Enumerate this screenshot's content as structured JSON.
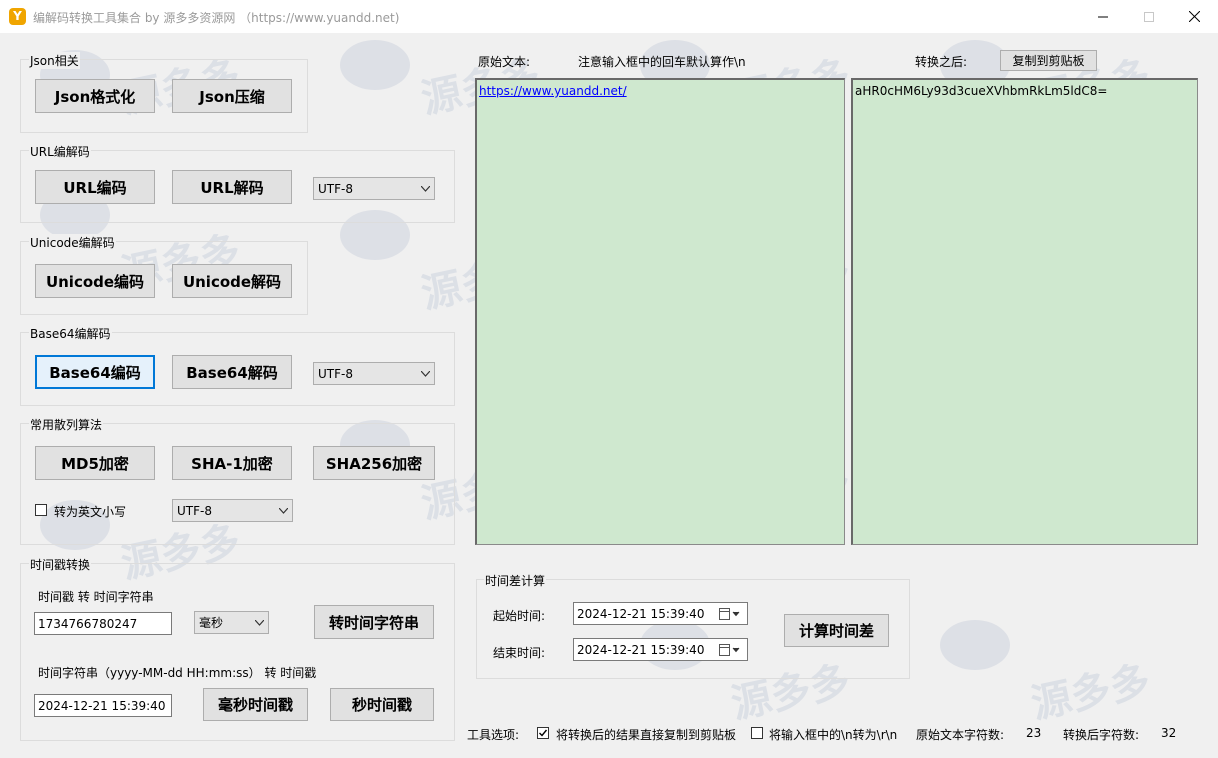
{
  "window": {
    "title": "编解码转换工具集合 by 源多多资源网 （https://www.yuandd.net)",
    "icon_glyph": "Y"
  },
  "json_group": {
    "label": "Json相关",
    "format_btn": "Json格式化",
    "compress_btn": "Json压缩"
  },
  "url_group": {
    "label": "URL编解码",
    "encode_btn": "URL编码",
    "decode_btn": "URL解码",
    "charset": "UTF-8"
  },
  "unicode_group": {
    "label": "Unicode编解码",
    "encode_btn": "Unicode编码",
    "decode_btn": "Unicode解码"
  },
  "base64_group": {
    "label": "Base64编解码",
    "encode_btn": "Base64编码",
    "decode_btn": "Base64解码",
    "charset": "UTF-8"
  },
  "hash_group": {
    "label": "常用散列算法",
    "md5_btn": "MD5加密",
    "sha1_btn": "SHA-1加密",
    "sha256_btn": "SHA256加密",
    "lowercase_label": "转为英文小写",
    "lowercase_checked": false,
    "charset": "UTF-8"
  },
  "timestamp_group": {
    "label": "时间戳转换",
    "ts_to_str_label": "时间戳 转 时间字符串",
    "ts_value": "1734766780247",
    "unit": "毫秒",
    "to_str_btn": "转时间字符串",
    "str_to_ts_label": "时间字符串（yyyy-MM-dd HH:mm:ss） 转 时间戳",
    "str_value": "2024-12-21 15:39:40",
    "ms_btn": "毫秒时间戳",
    "s_btn": "秒时间戳"
  },
  "main": {
    "orig_label": "原始文本:",
    "hint": "注意输入框中的回车默认算作\\n",
    "after_label": "转换之后:",
    "copy_btn": "复制到剪贴板",
    "orig_text": "https://www.yuandd.net/",
    "result_text": "aHR0cHM6Ly93d3cueXVhbmRkLm5ldC8="
  },
  "timediff_group": {
    "label": "时间差计算",
    "start_label": "起始时间:",
    "start_value": "2024-12-21 15:39:40",
    "end_label": "结束时间:",
    "end_value": "2024-12-21 15:39:40",
    "calc_btn": "计算时间差"
  },
  "footer": {
    "options_label": "工具选项:",
    "auto_copy_label": "将转换后的结果直接复制到剪贴板",
    "auto_copy_checked": true,
    "convert_newline_label": "将输入框中的\\n转为\\r\\n",
    "convert_newline_checked": false,
    "orig_count_label": "原始文本字符数:",
    "orig_count": "23",
    "result_count_label": "转换后字符数:",
    "result_count": "32"
  },
  "watermark": {
    "text": "源多多",
    "color": "#3a5a96"
  },
  "colors": {
    "textarea_bg": "#cfe8cf",
    "focus_border": "#0078d7",
    "link": "#0000ff"
  }
}
